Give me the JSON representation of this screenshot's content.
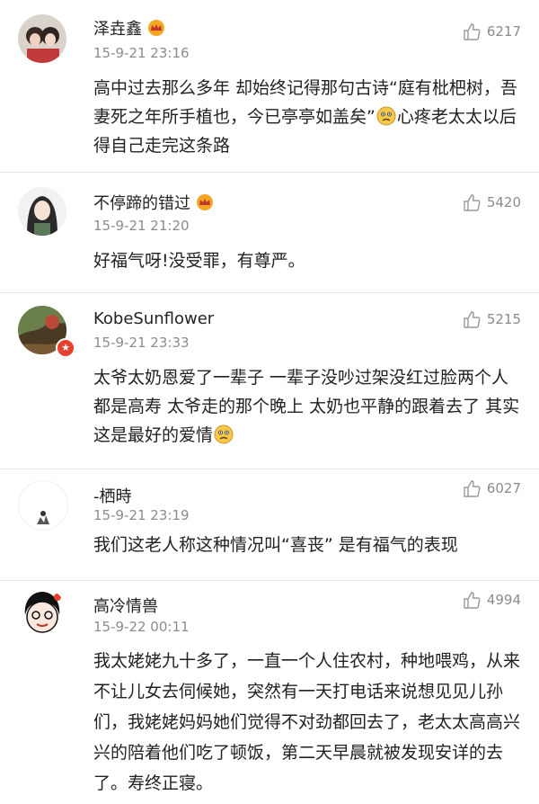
{
  "comments": [
    {
      "username": "泽垚鑫",
      "time": "15-9-21 23:16",
      "likes": "6217",
      "text_parts": [
        "高中过去那么多年 却始终记得那句古诗“庭有枇杷树，吾妻死之年所手植也，今已亭亭如盖矣”",
        "心疼老太太以后得自己走完这条路"
      ],
      "has_crown": true
    },
    {
      "username": "不停蹄的错过",
      "time": "15-9-21 21:20",
      "likes": "5420",
      "text_parts": [
        "好福气呀!没受罪，有尊严。"
      ],
      "has_crown": true
    },
    {
      "username": "KobeSunflower",
      "time": "15-9-21 23:33",
      "likes": "5215",
      "text_parts": [
        "太爷太奶恩爱了一辈子 一辈子没吵过架没红过脸两个人都是高寿 太爷走的那个晚上 太奶也平静的跟着去了 其实这是最好的爱情"
      ],
      "has_crown": false
    },
    {
      "username": "-栖時",
      "time": "15-9-21 23:19",
      "likes": "6027",
      "text_parts": [
        "我们这老人称这种情况叫“喜丧” 是有福气的表现"
      ],
      "has_crown": false
    },
    {
      "username": "高冷情兽",
      "time": "15-9-22 00:11",
      "likes": "4994",
      "text_parts": [
        "我太姥姥九十多了，一直一个人住农村，种地喂鸡，从来不让儿女去伺候她，突然有一天打电话来说想见见儿孙们，我姥姥妈妈她们觉得不对劲都回去了，老太太高高兴兴的陪着他们吃了顿饭，第二天早晨就被发现安详的去了。寿终正寝。"
      ],
      "has_crown": false
    }
  ],
  "colors": {
    "text": "#222222",
    "meta": "#8c8c8c",
    "crown": "#f5a623",
    "emoji": "#f7c948"
  }
}
